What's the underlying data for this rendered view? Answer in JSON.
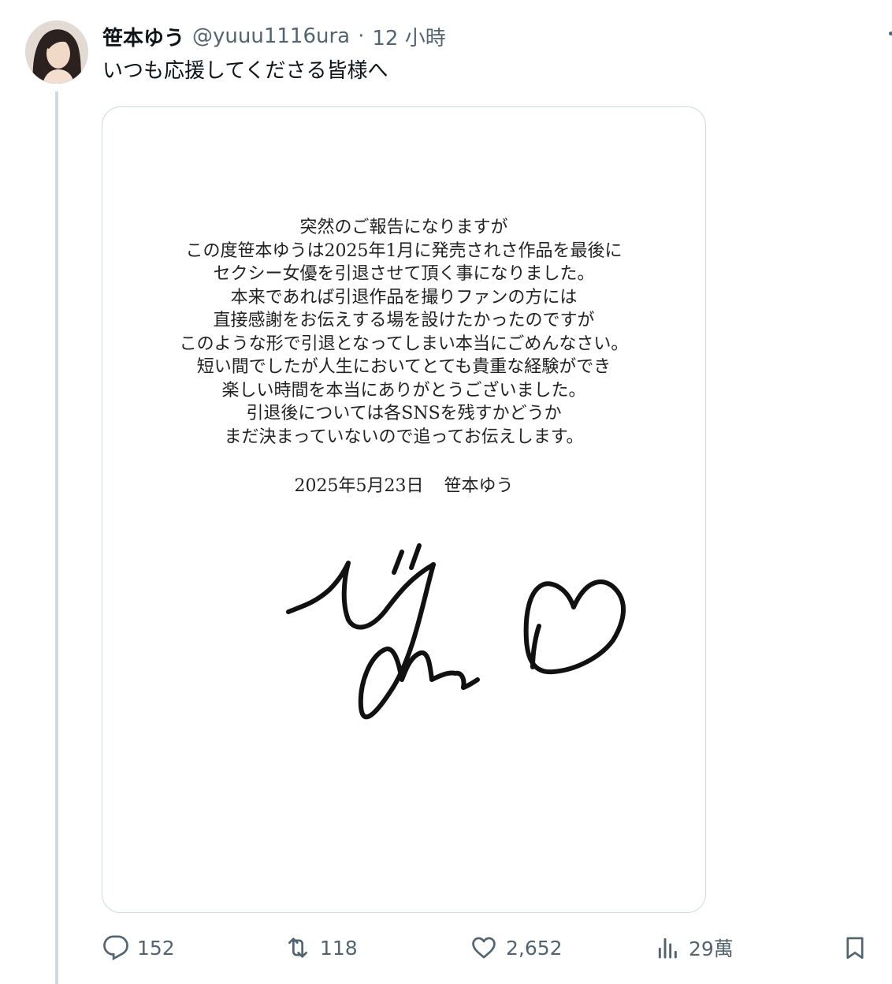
{
  "tweet": {
    "author": {
      "display_name": "笹本ゆう",
      "handle": "@yuuu1116ura",
      "time": "12 小時",
      "separator": "·"
    },
    "text": "いつも応援してくださる皆様へ",
    "image": {
      "lines": [
        "突然のご報告になりますが",
        "この度笹本ゆうは2025年1月に発売されさ作品を最後に",
        "セクシー女優を引退させて頂く事になりました。",
        "本来であれば引退作品を撮りファンの方には",
        "直接感謝をお伝えする場を設けたかったのですが",
        "このような形で引退となってしまい本当にごめんなさい。",
        "短い間でしたが人生においてとても貴重な経験ができ",
        "楽しい時間を本当にありがとうございました。",
        "引退後については各SNSを残すかどうか",
        "まだ決まっていないので追ってお伝えします。"
      ],
      "date": "2025年5月23日",
      "signed": "笹本ゆう"
    },
    "actions": {
      "replies": "152",
      "retweets": "118",
      "likes": "2,652",
      "views": "29萬"
    }
  },
  "icons": {
    "reply": "reply-icon",
    "retweet": "retweet-icon",
    "like": "heart-icon",
    "views": "views-icon",
    "bookmark": "bookmark-icon",
    "more": "more-icon"
  },
  "colors": {
    "text": "#0f1419",
    "secondary": "#536471",
    "border": "#cfd9de"
  }
}
